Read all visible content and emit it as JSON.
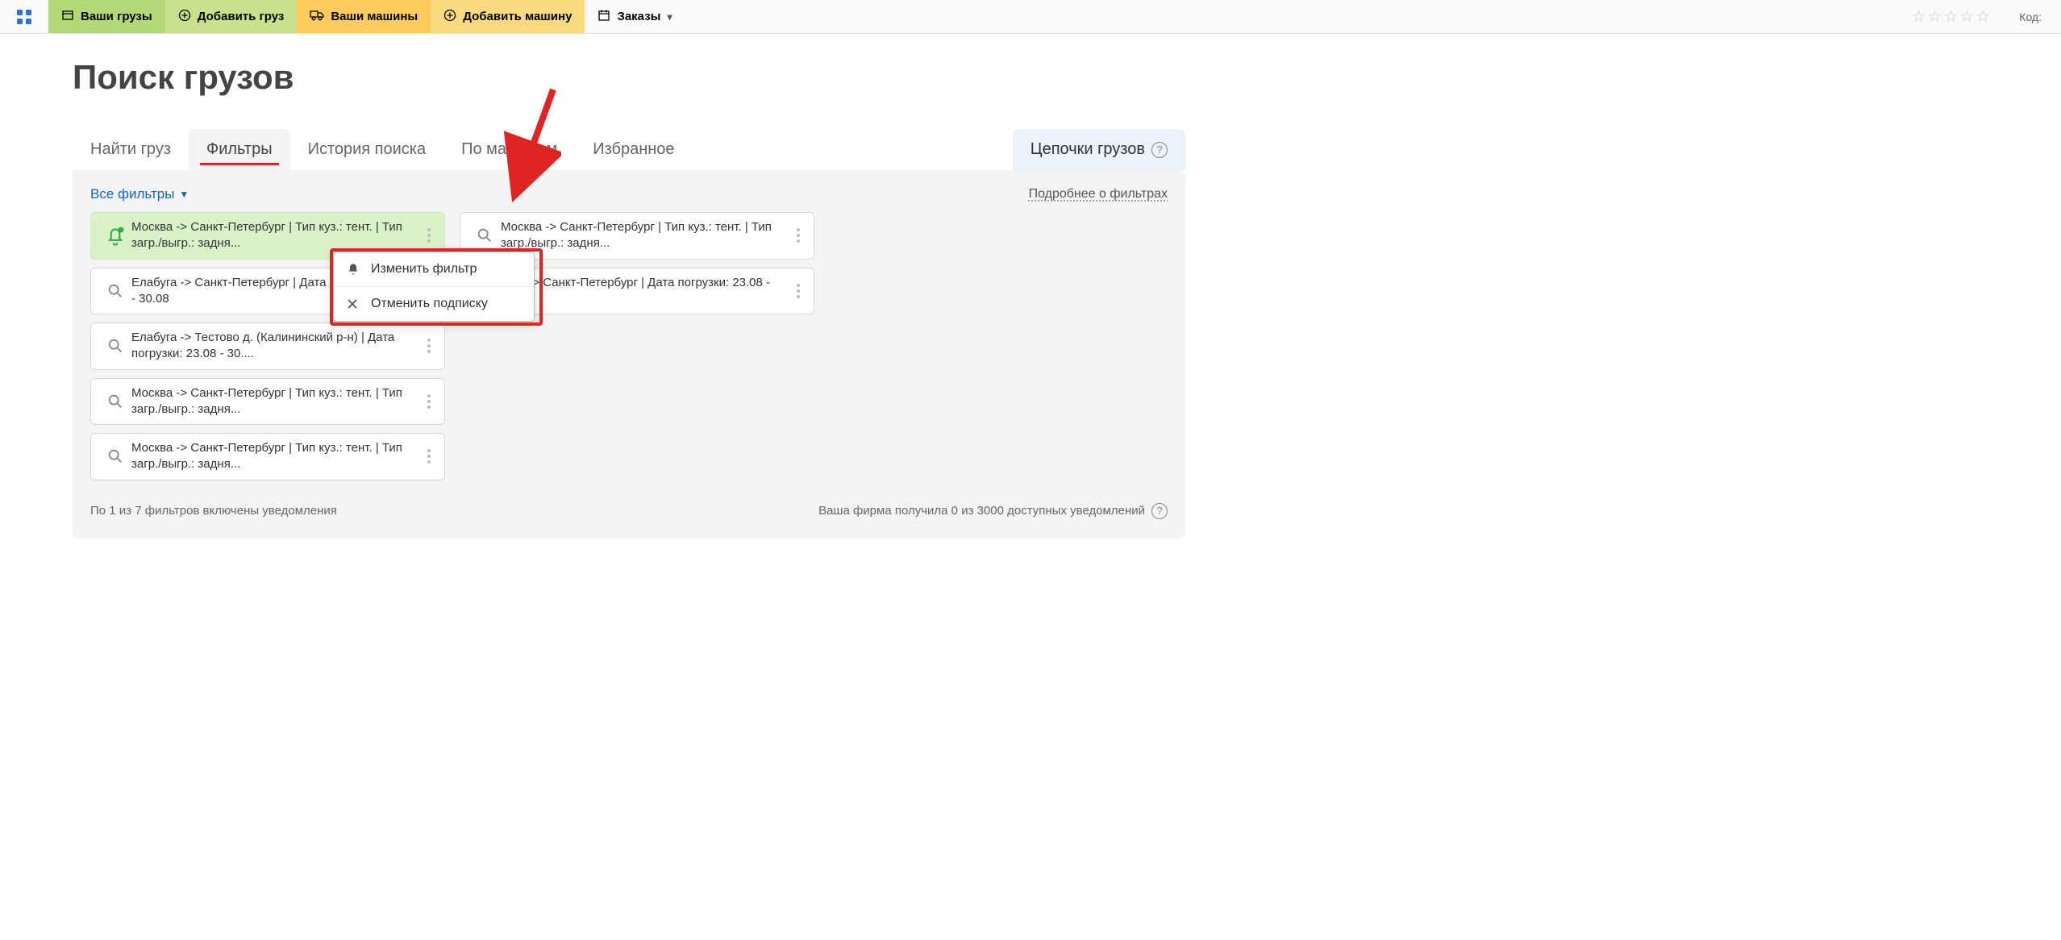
{
  "topbar": {
    "nav_cargo": "Ваши грузы",
    "add_cargo": "Добавить груз",
    "nav_trucks": "Ваши машины",
    "add_truck": "Добавить машину",
    "orders": "Заказы",
    "code_label": "Код:"
  },
  "page_title": "Поиск грузов",
  "tabs": {
    "find": "Найти груз",
    "filters": "Фильтры",
    "history": "История поиска",
    "by_trucks": "По машинам",
    "favorites": "Избранное",
    "chains": "Цепочки грузов"
  },
  "panel": {
    "all_filters": "Все фильтры",
    "about_filters": "Подробнее о фильтрах",
    "foot_left": "По 1 из 7 фильтров включены уведомления",
    "foot_right": "Ваша фирма получила 0 из 3000 доступных уведомлений"
  },
  "cards": {
    "left": [
      "Москва -> Санкт-Петербург | Тип куз.: тент. | Тип загр./выгр.: задня...",
      "Елабуга -> Санкт-Петербург | Дата погрузки: 23.08 - 30.08",
      "Елабуга -> Тестово д. (Калининский р-н) | Дата погрузки: 23.08 - 30....",
      "Москва -> Санкт-Петербург | Тип куз.: тент. | Тип загр./выгр.: задня...",
      "Москва -> Санкт-Петербург | Тип куз.: тент. | Тип загр./выгр.: задня..."
    ],
    "right": [
      "Москва -> Санкт-Петербург | Тип куз.: тент. | Тип загр./выгр.: задня...",
      "Уфа -> Санкт-Петербург | Дата погрузки: 23.08 - 30.08"
    ]
  },
  "menu": {
    "edit": "Изменить фильтр",
    "unsub": "Отменить подписку"
  }
}
